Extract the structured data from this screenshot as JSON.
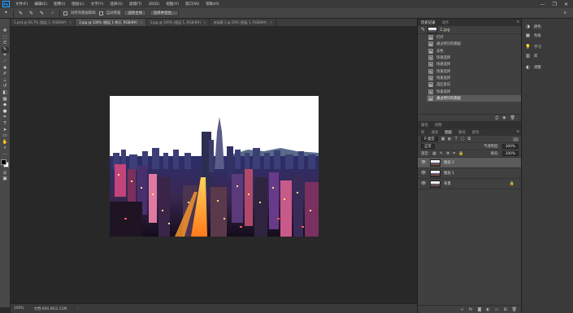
{
  "app": {
    "logo": "Ps",
    "menu": [
      "文件(F)",
      "编辑(E)",
      "图像(I)",
      "图层(L)",
      "文字(Y)",
      "选择(S)",
      "滤镜(T)",
      "3D(D)",
      "视图(V)",
      "窗口(W)",
      "帮助(H)"
    ],
    "window_controls": [
      "—",
      "❐",
      "✕"
    ]
  },
  "options": {
    "sample_all_layers": "对所有图层取样",
    "auto_enhance": "自动增强",
    "select_subject": "选择主体",
    "select_and_mask": "选择并遮住...",
    "icons": [
      "brush-tool-icon",
      "new-selection-icon",
      "add-selection-icon",
      "subtract-selection-icon",
      "brush-size-icon",
      "sample-all-checkbox"
    ]
  },
  "doc_tabs": [
    {
      "label": "1.psd @ 66.7% (图层 1, RGB/8#)",
      "active": false
    },
    {
      "label": "2.jpg @ 100% (图层 1 拷贝, RGB/8#)",
      "active": true
    },
    {
      "label": "3.jpg @ 100% (图层 1, RGB/8#)",
      "active": false
    },
    {
      "label": "未标题-1 @ 50% (图层 1, RGB/8#)",
      "active": false
    }
  ],
  "status": {
    "zoom": "100%",
    "doc_size": "文档:600.0K/2.53M"
  },
  "history": {
    "tabs": [
      "历史记录",
      "动作"
    ],
    "snapshot_name": "2.jpg",
    "items": [
      {
        "label": "打开",
        "icon": "doc"
      },
      {
        "label": "通过拷贝的图层",
        "icon": "doc"
      },
      {
        "label": "去色",
        "icon": "doc"
      },
      {
        "label": "快速选择",
        "icon": "brush"
      },
      {
        "label": "快速选择",
        "icon": "brush"
      },
      {
        "label": "快速选择",
        "icon": "brush"
      },
      {
        "label": "快速选择",
        "icon": "brush"
      },
      {
        "label": "选区反向",
        "icon": "doc"
      },
      {
        "label": "快速选择",
        "icon": "brush"
      },
      {
        "label": "通过拷贝的图层",
        "icon": "doc",
        "active": true
      }
    ]
  },
  "properties": {
    "tabs": [
      "属性",
      "调整"
    ]
  },
  "layers": {
    "tabs": [
      "库",
      "通道",
      "图层",
      "路径",
      "颜色"
    ],
    "active_tab": "图层",
    "filter_label": "P 类型",
    "blend_mode": "正常",
    "opacity_label": "不透明度:",
    "opacity_value": "100%",
    "lock_label": "锁定:",
    "fill_label": "填充:",
    "fill_value": "100%",
    "items": [
      {
        "name": "图层 2",
        "selected": true,
        "locked": false
      },
      {
        "name": "图层 1",
        "selected": false,
        "locked": false
      },
      {
        "name": "背景",
        "selected": false,
        "locked": true
      }
    ],
    "footer_icons": [
      "link-icon",
      "fx-icon",
      "mask-icon",
      "adjustment-icon",
      "group-icon",
      "new-layer-icon",
      "trash-icon"
    ]
  },
  "right_strip": {
    "groups": [
      [
        {
          "label": "颜色",
          "icon": "color-icon"
        },
        {
          "label": "色板",
          "icon": "swatches-icon"
        }
      ],
      [
        {
          "label": "学习",
          "icon": "learn-icon"
        },
        {
          "label": "库",
          "icon": "libraries-icon"
        }
      ],
      [
        {
          "label": "调整",
          "icon": "adjustments-icon"
        }
      ]
    ]
  }
}
